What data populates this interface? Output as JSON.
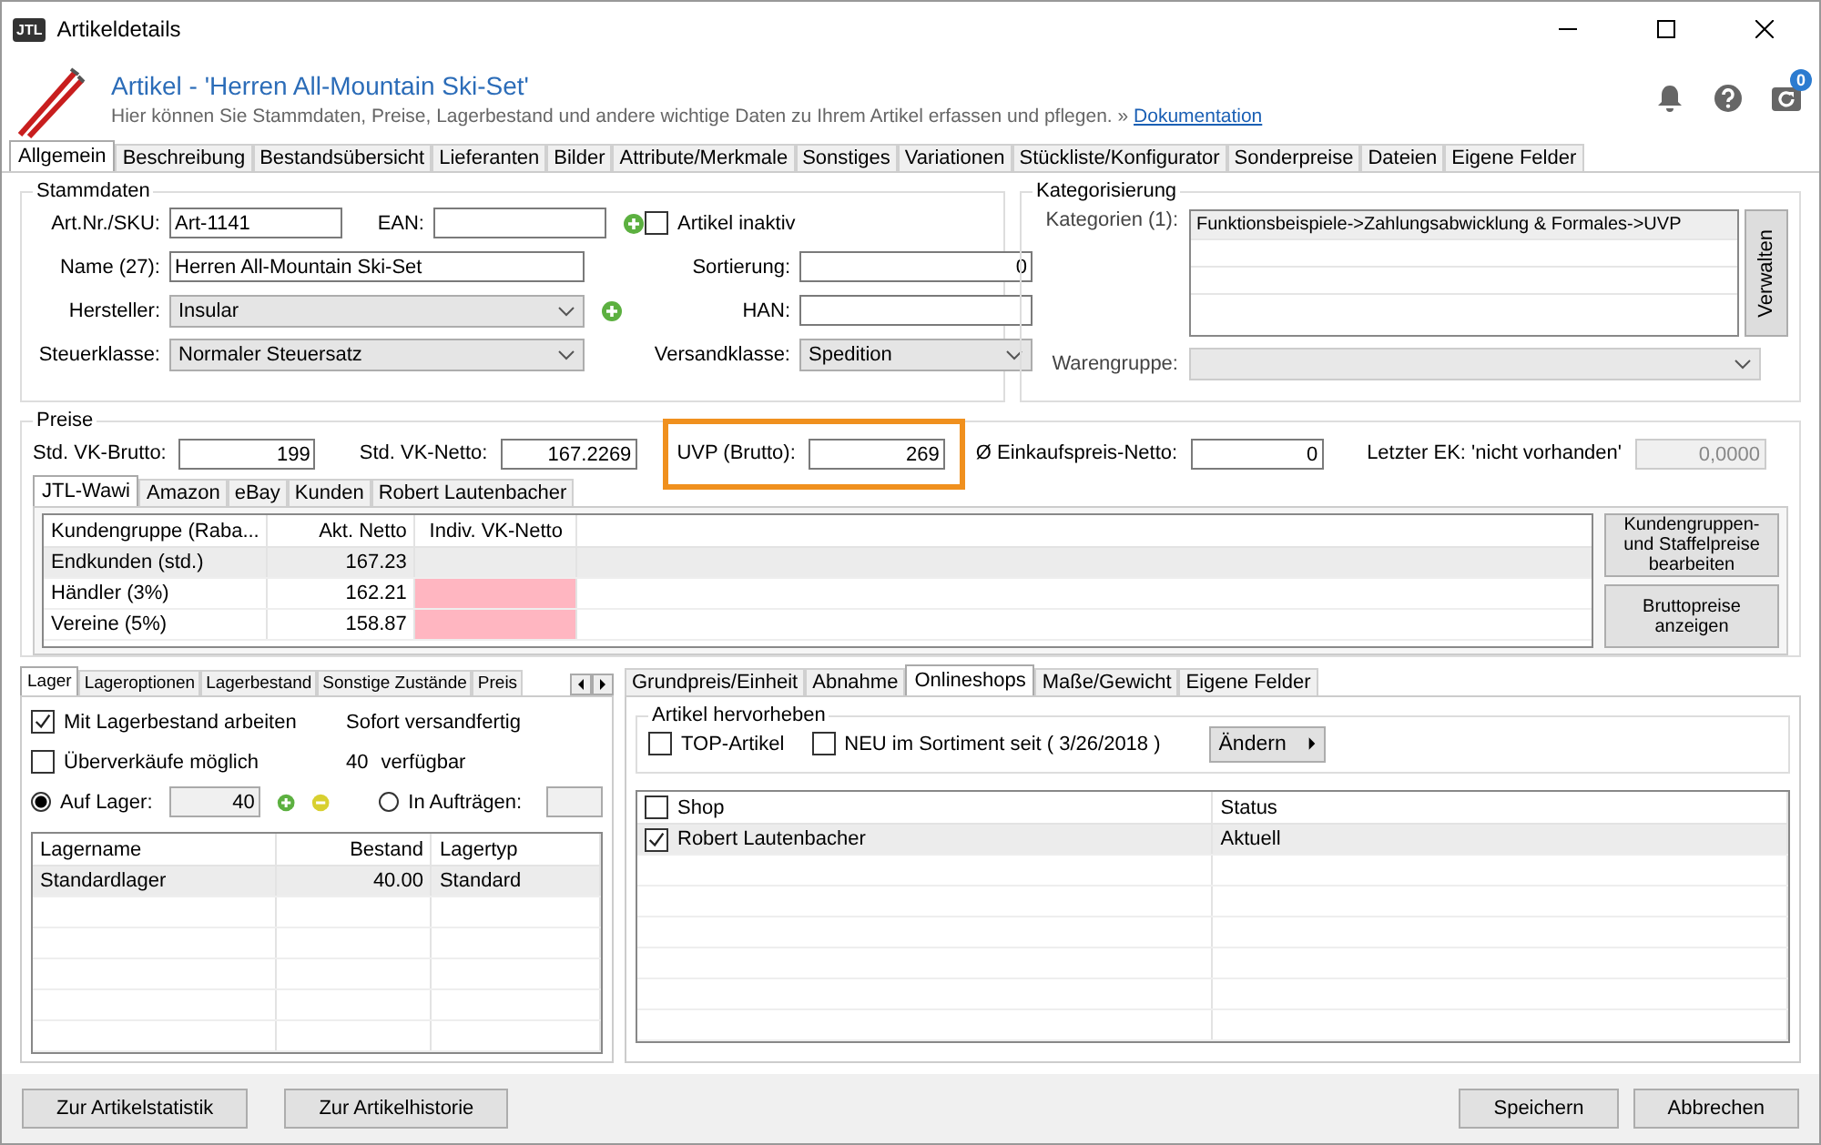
{
  "window": {
    "title": "Artikeldetails",
    "app_icon_text": "JTL"
  },
  "header": {
    "title": "Artikel - 'Herren All-Mountain Ski-Set'",
    "subtitle": "Hier können Sie Stammdaten, Preise, Lagerbestand und andere wichtige Daten zu Ihrem Artikel erfassen und pflegen. »",
    "link": "Dokumentation",
    "badge": "0"
  },
  "tabs": [
    {
      "label": "Allgemein",
      "selected": true
    },
    {
      "label": "Beschreibung",
      "selected": false
    },
    {
      "label": "Bestandsübersicht",
      "selected": false
    },
    {
      "label": "Lieferanten",
      "selected": false
    },
    {
      "label": "Bilder",
      "selected": false
    },
    {
      "label": "Attribute/Merkmale",
      "selected": false
    },
    {
      "label": "Sonstiges",
      "selected": false
    },
    {
      "label": "Variationen",
      "selected": false
    },
    {
      "label": "Stückliste/Konfigurator",
      "selected": false
    },
    {
      "label": "Sonderpreise",
      "selected": false
    },
    {
      "label": "Dateien",
      "selected": false
    },
    {
      "label": "Eigene Felder",
      "selected": false
    }
  ],
  "stammdaten": {
    "title": "Stammdaten",
    "sku": {
      "label": "Art.Nr./SKU:",
      "value": "Art-1141"
    },
    "ean": {
      "label": "EAN:"
    },
    "name": {
      "label": "Name (27):",
      "value": "Herren All-Mountain Ski-Set"
    },
    "hersteller": {
      "label": "Hersteller:",
      "value": "Insular"
    },
    "steuerklasse": {
      "label": "Steuerklasse:",
      "value": "Normaler Steuersatz"
    },
    "artikel_inaktiv": {
      "label": "Artikel inaktiv",
      "checked": false
    },
    "sortierung": {
      "label": "Sortierung:",
      "value": "0"
    },
    "han": {
      "label": "HAN:"
    },
    "versandklasse": {
      "label": "Versandklasse:",
      "value": "Spedition"
    }
  },
  "kategorisierung": {
    "title": "Kategorisierung",
    "kategorien_label": "Kategorien (1):",
    "kategorien": [
      "Funktionsbeispiele->Zahlungsabwicklung & Formales->UVP"
    ],
    "manage_button": "Verwalten",
    "warengruppe_label": "Warengruppe:"
  },
  "preise": {
    "title": "Preise",
    "fields": [
      {
        "label": "Std. VK-Brutto:",
        "value": "199",
        "highlighted": false,
        "disabled": false
      },
      {
        "label": "Std. VK-Netto:",
        "value": "167.2269",
        "highlighted": false,
        "disabled": false
      },
      {
        "label": "UVP (Brutto):",
        "value": "269",
        "highlighted": true,
        "disabled": false
      },
      {
        "label": "Ø Einkaufspreis-Netto:",
        "value": "0",
        "highlighted": false,
        "disabled": false
      },
      {
        "label": "Letzter EK: 'nicht vorhanden'",
        "value": "0,0000",
        "highlighted": false,
        "disabled": true
      }
    ],
    "tabs": [
      {
        "label": "JTL-Wawi",
        "selected": true
      },
      {
        "label": "Amazon",
        "selected": false
      },
      {
        "label": "eBay",
        "selected": false
      },
      {
        "label": "Kunden",
        "selected": false
      },
      {
        "label": "Robert Lautenbacher",
        "selected": false
      }
    ],
    "columns": [
      "Kundengruppe (Raba...",
      "Akt. Netto",
      "Indiv. VK-Netto"
    ],
    "rows": [
      {
        "group": "Endkunden (std.)",
        "netto": "167.23",
        "selected": true,
        "invalid": false
      },
      {
        "group": "Händler (3%)",
        "netto": "162.21",
        "selected": false,
        "invalid": true
      },
      {
        "group": "Vereine (5%)",
        "netto": "158.87",
        "selected": false,
        "invalid": true
      }
    ],
    "buttons": [
      "Kundengruppen- und Staffelpreise bearbeiten",
      "Bruttopreise anzeigen"
    ]
  },
  "lager": {
    "tabs": [
      {
        "label": "Lager",
        "selected": true
      },
      {
        "label": "Lageroptionen",
        "selected": false
      },
      {
        "label": "Lagerbestand",
        "selected": false
      },
      {
        "label": "Sonstige Zustände",
        "selected": false
      },
      {
        "label": "Preis",
        "selected": false
      }
    ],
    "mit_lagerbestand": {
      "label": "Mit Lagerbestand arbeiten",
      "checked": true
    },
    "ueberverkaeufe": {
      "label": "Überverkäufe möglich",
      "checked": false
    },
    "status": "Sofort versandfertig",
    "available_count": "40",
    "available_label": "verfügbar",
    "radios": [
      {
        "label": "Auf Lager:",
        "selected": true,
        "value": "40"
      },
      {
        "label": "In Aufträgen:",
        "selected": false
      }
    ],
    "columns": [
      "Lagername",
      "Bestand",
      "Lagertyp"
    ],
    "rows": [
      {
        "name": "Standardlager",
        "bestand": "40.00",
        "typ": "Standard",
        "selected": true
      }
    ]
  },
  "shops": {
    "tabs": [
      {
        "label": "Grundpreis/Einheit",
        "selected": false
      },
      {
        "label": "Abnahme",
        "selected": false
      },
      {
        "label": "Onlineshops",
        "selected": true
      },
      {
        "label": "Maße/Gewicht",
        "selected": false
      },
      {
        "label": "Eigene Felder",
        "selected": false
      }
    ],
    "hervorheben": {
      "title": "Artikel hervorheben",
      "checks": [
        {
          "label": "TOP-Artikel",
          "checked": false
        },
        {
          "label": "NEU im Sortiment seit ( 3/26/2018 )",
          "checked": false
        }
      ],
      "button": "Ändern"
    },
    "columns": [
      "Shop",
      "Status"
    ],
    "all_checked": false,
    "rows": [
      {
        "shop": "Robert Lautenbacher",
        "status": "Aktuell",
        "checked": true,
        "selected": true
      }
    ]
  },
  "footer": {
    "left_buttons": [
      "Zur Artikelstatistik",
      "Zur Artikelhistorie"
    ],
    "right_buttons": [
      "Speichern",
      "Abbrechen"
    ]
  }
}
